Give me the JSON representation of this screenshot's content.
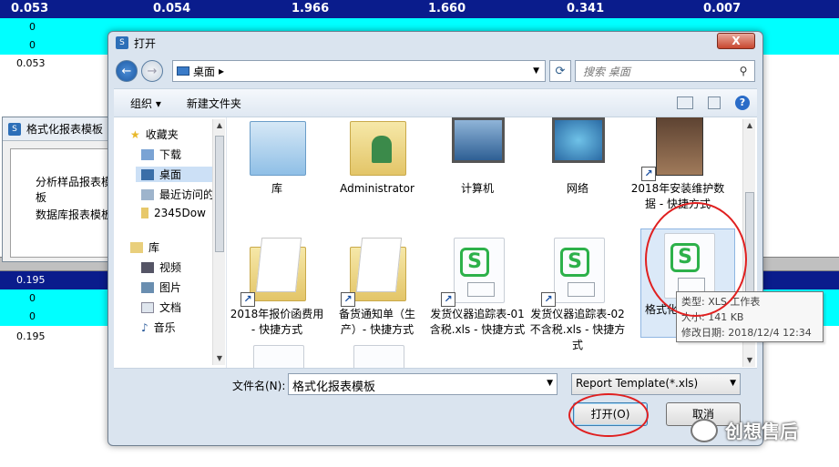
{
  "spreadsheet": {
    "header_values": [
      "0.053",
      "0.054",
      "1.966",
      "1.660",
      "0.341",
      "0.007"
    ],
    "row_a": [
      "0",
      "0"
    ],
    "row_b": [
      "0",
      "0"
    ],
    "val_top": "0.053",
    "lower_header_partial": "0.195",
    "lower_rows": [
      "0",
      "0"
    ],
    "val_bottom": "0.195"
  },
  "bg_dialog": {
    "title": "格式化报表模板",
    "items": [
      "分析样品报表模板",
      "数据库报表模板"
    ]
  },
  "dialog": {
    "title": "打开",
    "close_label": "X",
    "path": "桌面",
    "path_sep": "▸",
    "search_placeholder": "搜索 桌面",
    "toolbar": {
      "organize": "组织 ▾",
      "new_folder": "新建文件夹"
    },
    "sidebar": {
      "favorites": "收藏夹",
      "downloads": "下载",
      "desktop": "桌面",
      "recent": "最近访问的",
      "user_folder": "2345Dow",
      "libraries": "库",
      "videos": "视频",
      "pictures": "图片",
      "documents": "文档",
      "music": "音乐"
    },
    "files": [
      {
        "label": "库"
      },
      {
        "label": "Administrator"
      },
      {
        "label": "计算机"
      },
      {
        "label": "网络"
      },
      {
        "label": "2018年安装维护数据 - 快捷方式"
      },
      {
        "label": "2018年报价函费用 - 快捷方式"
      },
      {
        "label": "备货通知单（生产）- 快捷方式"
      },
      {
        "label": "发货仪器追踪表-01含税.xls - 快捷方式"
      },
      {
        "label": "发货仪器追踪表-02不含税.xls - 快捷方式"
      },
      {
        "label": "格式化"
      }
    ],
    "tooltip": {
      "type": "类型: XLS 工作表",
      "size": "大小: 141 KB",
      "modified": "修改日期: 2018/12/4 12:34"
    },
    "filename_label": "文件名(N):",
    "filename_value": "格式化报表模板",
    "filetype_value": "Report Template(*.xls)",
    "open_button": "打开(O)",
    "cancel_button": "取消"
  },
  "watermark": "创想售后",
  "colors": {
    "header_navy": "#0a1c8c",
    "cyan_row": "#00ffff",
    "highlight_ring": "#e02020",
    "xls_green": "#2db14a"
  }
}
